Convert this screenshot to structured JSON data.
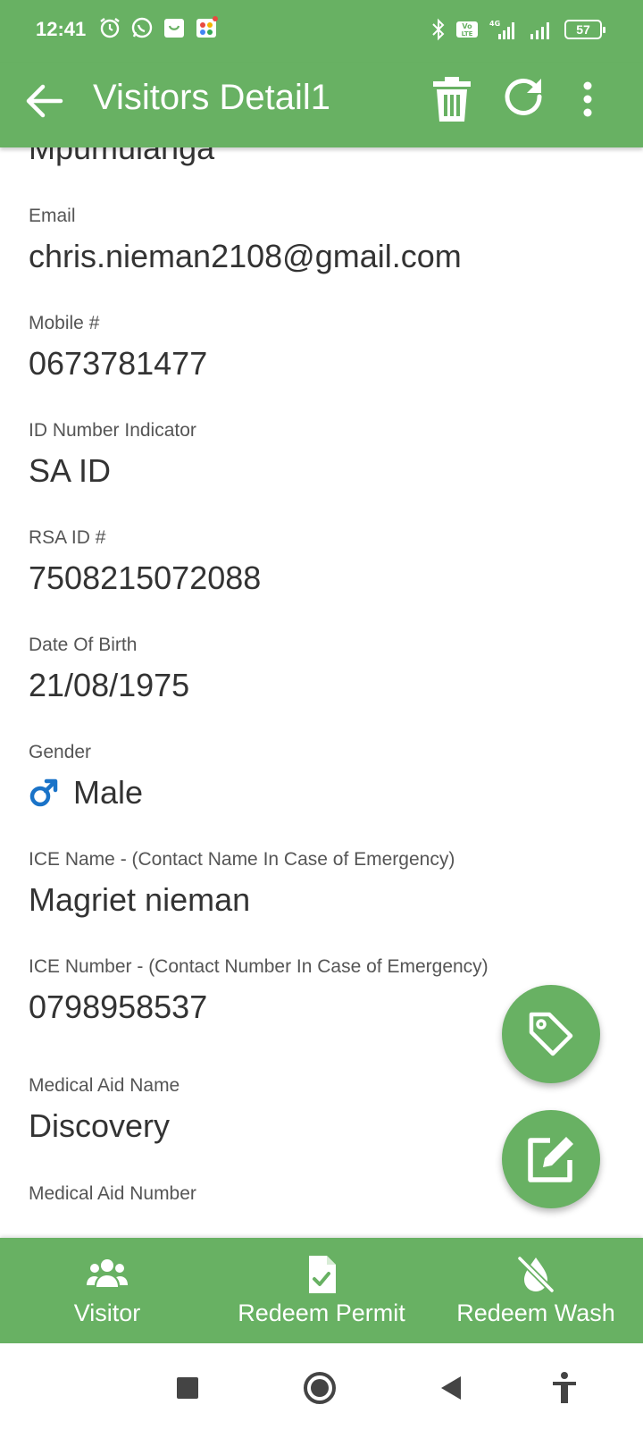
{
  "status": {
    "time": "12:41",
    "battery": "57"
  },
  "appbar": {
    "title": "Visitors Detail1"
  },
  "partial_field": {
    "value": "Mpumulanga"
  },
  "fields": [
    {
      "label": "Email",
      "value": "chris.nieman2108@gmail.com"
    },
    {
      "label": "Mobile #",
      "value": "0673781477"
    },
    {
      "label": "ID Number Indicator",
      "value": "SA ID"
    },
    {
      "label": "RSA ID #",
      "value": "7508215072088"
    },
    {
      "label": "Date Of Birth",
      "value": "21/08/1975"
    },
    {
      "label": "Gender",
      "value": "Male"
    },
    {
      "label": "ICE Name - (Contact Name In Case of Emergency)",
      "value": "Magriet nieman"
    },
    {
      "label": "ICE Number - (Contact Number In Case of Emergency)",
      "value": "0798958537"
    },
    {
      "label": "Medical Aid Name",
      "value": "Discovery"
    },
    {
      "label": "Medical Aid Number",
      "value": ""
    }
  ],
  "bottom_nav": [
    {
      "label": "Visitor",
      "icon": "users-icon"
    },
    {
      "label": "Redeem Permit",
      "icon": "file-check-icon"
    },
    {
      "label": "Redeem Wash",
      "icon": "no-water-icon"
    }
  ],
  "colors": {
    "primary": "#68b163",
    "gender_icon": "#1a73c8",
    "text": "#333333",
    "label": "#555555"
  }
}
